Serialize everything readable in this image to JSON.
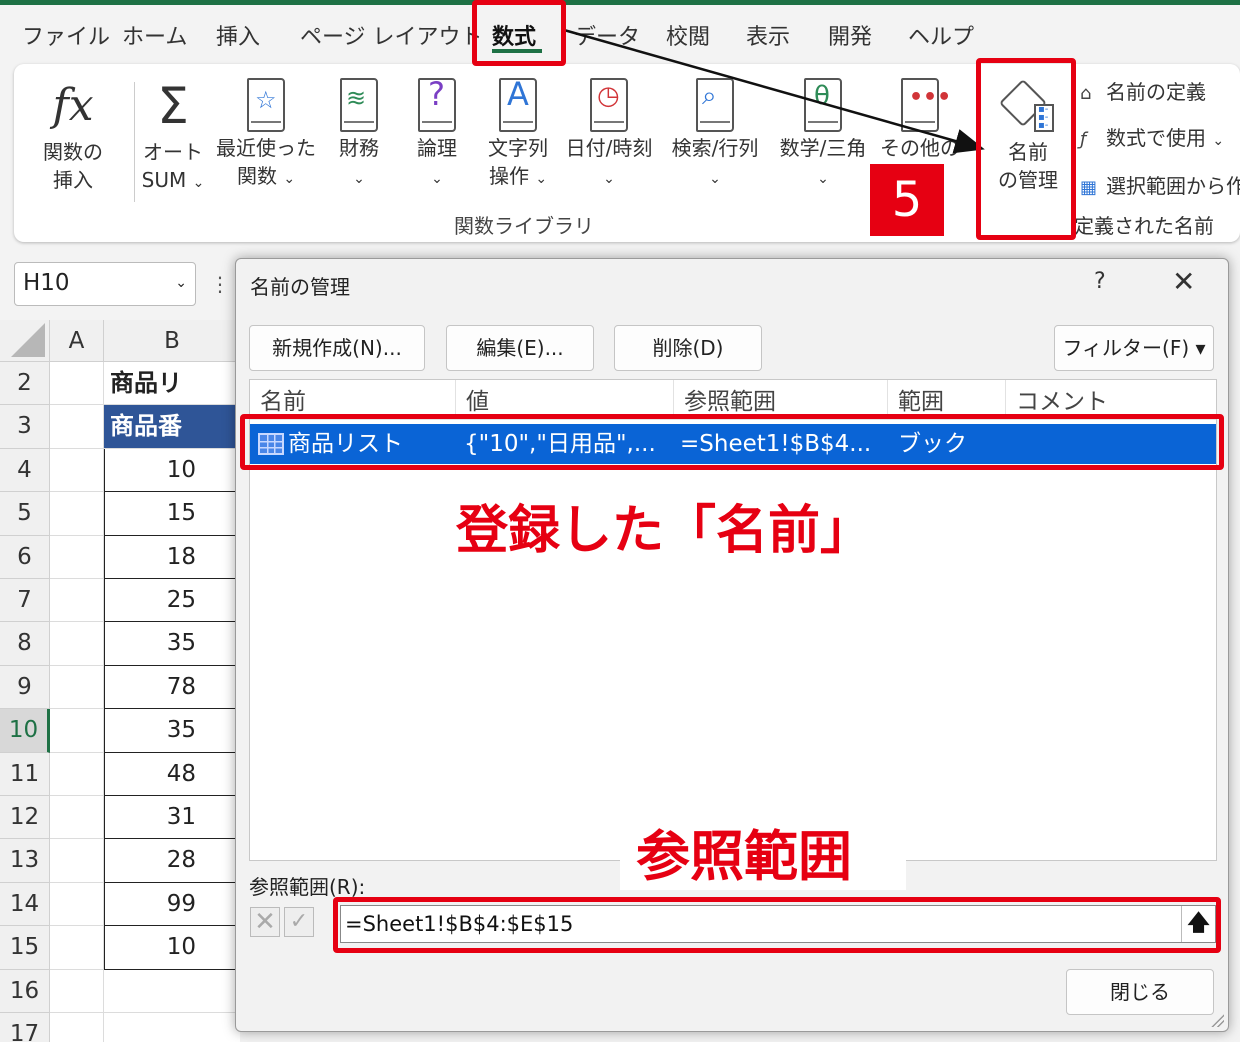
{
  "tabs": [
    "ファイル",
    "ホーム",
    "挿入",
    "ページ レイアウト",
    "数式",
    "データ",
    "校閲",
    "表示",
    "開発",
    "ヘルプ"
  ],
  "active_tab": "数式",
  "ribbon": {
    "insert_function": [
      "関数の",
      "挿入"
    ],
    "autosum": [
      "オート",
      "SUM"
    ],
    "recent": [
      "最近使った",
      "関数"
    ],
    "financial": "財務",
    "logical": "論理",
    "text": [
      "文字列",
      "操作"
    ],
    "datetime": "日付/時刻",
    "lookup": "検索/行列",
    "math": "数学/三角",
    "other": "その他の",
    "name_manager": [
      "名前",
      "の管理"
    ],
    "group_label": "関数ライブラリ",
    "define_name": "名前の定義",
    "use_in_formula": "数式で使用",
    "create_from_selection": "選択範囲から作",
    "defined_names_label": "定義された名前",
    "chevron": "⌄"
  },
  "namebox": {
    "value": "H10",
    "chevron": "⌄",
    "dots": "⋮"
  },
  "grid": {
    "columns": [
      "A",
      "B"
    ],
    "rows": [
      {
        "num": "2",
        "b": "商品リスト",
        "kind": "title"
      },
      {
        "num": "3",
        "b": "商品番号",
        "kind": "hdr"
      },
      {
        "num": "4",
        "b": "10",
        "kind": "val"
      },
      {
        "num": "5",
        "b": "15",
        "kind": "val"
      },
      {
        "num": "6",
        "b": "18",
        "kind": "val"
      },
      {
        "num": "7",
        "b": "25",
        "kind": "val"
      },
      {
        "num": "8",
        "b": "35",
        "kind": "val"
      },
      {
        "num": "9",
        "b": "78",
        "kind": "val"
      },
      {
        "num": "10",
        "b": "35",
        "kind": "val",
        "selected": true
      },
      {
        "num": "11",
        "b": "48",
        "kind": "val"
      },
      {
        "num": "12",
        "b": "31",
        "kind": "val"
      },
      {
        "num": "13",
        "b": "28",
        "kind": "val"
      },
      {
        "num": "14",
        "b": "99",
        "kind": "val"
      },
      {
        "num": "15",
        "b": "10",
        "kind": "val"
      },
      {
        "num": "16",
        "b": "",
        "kind": "empty"
      },
      {
        "num": "17",
        "b": "",
        "kind": "empty"
      }
    ]
  },
  "dialog": {
    "title": "名前の管理",
    "help": "?",
    "close": "✕",
    "buttons": {
      "new": "新規作成(N)...",
      "edit": "編集(E)...",
      "delete": "削除(D)",
      "filter": "フィルター(F) ▾"
    },
    "columns": [
      "名前",
      "値",
      "参照範囲",
      "範囲",
      "コメント"
    ],
    "entry": {
      "name": "商品リスト",
      "value": "{\"10\",\"日用品\",...",
      "ref": "=Sheet1!$B$4...",
      "scope": "ブック",
      "comment": ""
    },
    "ref_label": "参照範囲(R):",
    "ref_value": "=Sheet1!$B$4:$E$15",
    "ref_cancel": "✕",
    "ref_ok": "✓",
    "ref_collapse": "🡅",
    "close_button": "閉じる"
  },
  "annotations": {
    "step": "5",
    "registered_name": "登録した「名前」",
    "reference_range": "参照範囲",
    "color": "#e60012"
  }
}
